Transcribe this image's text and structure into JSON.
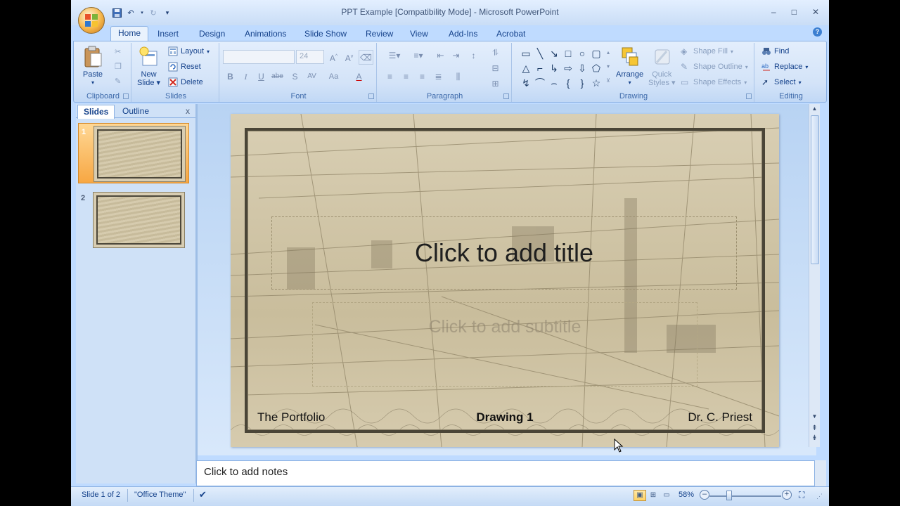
{
  "window": {
    "title": "PPT Example [Compatibility Mode] - Microsoft PowerPoint",
    "controls": [
      "–",
      "□",
      "✕"
    ]
  },
  "quick_access": {
    "icons": [
      "save-icon",
      "undo-icon",
      "redo-icon",
      "customize-icon"
    ]
  },
  "tabs": [
    {
      "label": "Home",
      "active": true
    },
    {
      "label": "Insert"
    },
    {
      "label": "Design"
    },
    {
      "label": "Animations"
    },
    {
      "label": "Slide Show"
    },
    {
      "label": "Review"
    },
    {
      "label": "View"
    },
    {
      "label": "Add-Ins"
    },
    {
      "label": "Acrobat"
    }
  ],
  "ribbon": {
    "clipboard": {
      "label": "Clipboard",
      "paste": "Paste"
    },
    "slides": {
      "label": "Slides",
      "new_slide_line1": "New",
      "new_slide_line2": "Slide",
      "layout": "Layout",
      "reset": "Reset",
      "delete": "Delete"
    },
    "font": {
      "label": "Font",
      "font_name": "",
      "font_size": "24",
      "bold": "B",
      "italic": "I",
      "underline": "U",
      "strike": "abe",
      "shadow": "S",
      "spacing": "AV",
      "case": "Aa",
      "color": "A"
    },
    "paragraph": {
      "label": "Paragraph"
    },
    "drawing": {
      "label": "Drawing",
      "arrange": "Arrange",
      "quick_styles_line1": "Quick",
      "quick_styles_line2": "Styles",
      "shape_fill": "Shape Fill",
      "shape_outline": "Shape Outline",
      "shape_effects": "Shape Effects"
    },
    "editing": {
      "label": "Editing",
      "find": "Find",
      "replace": "Replace",
      "select": "Select"
    }
  },
  "slides_pane": {
    "tabs": [
      "Slides",
      "Outline"
    ],
    "close": "x",
    "thumbnails": [
      {
        "number": "1",
        "selected": true
      },
      {
        "number": "2",
        "selected": false
      }
    ]
  },
  "slide": {
    "title_placeholder": "Click to add title",
    "subtitle_placeholder": "Click to add subtitle",
    "footer_left": "The Portfolio",
    "footer_center": "Drawing 1",
    "footer_right": "Dr. C. Priest"
  },
  "notes": {
    "placeholder": "Click to add notes"
  },
  "status": {
    "slide_info": "Slide 1 of 2",
    "theme": "\"Office Theme\"",
    "zoom": "58%"
  }
}
